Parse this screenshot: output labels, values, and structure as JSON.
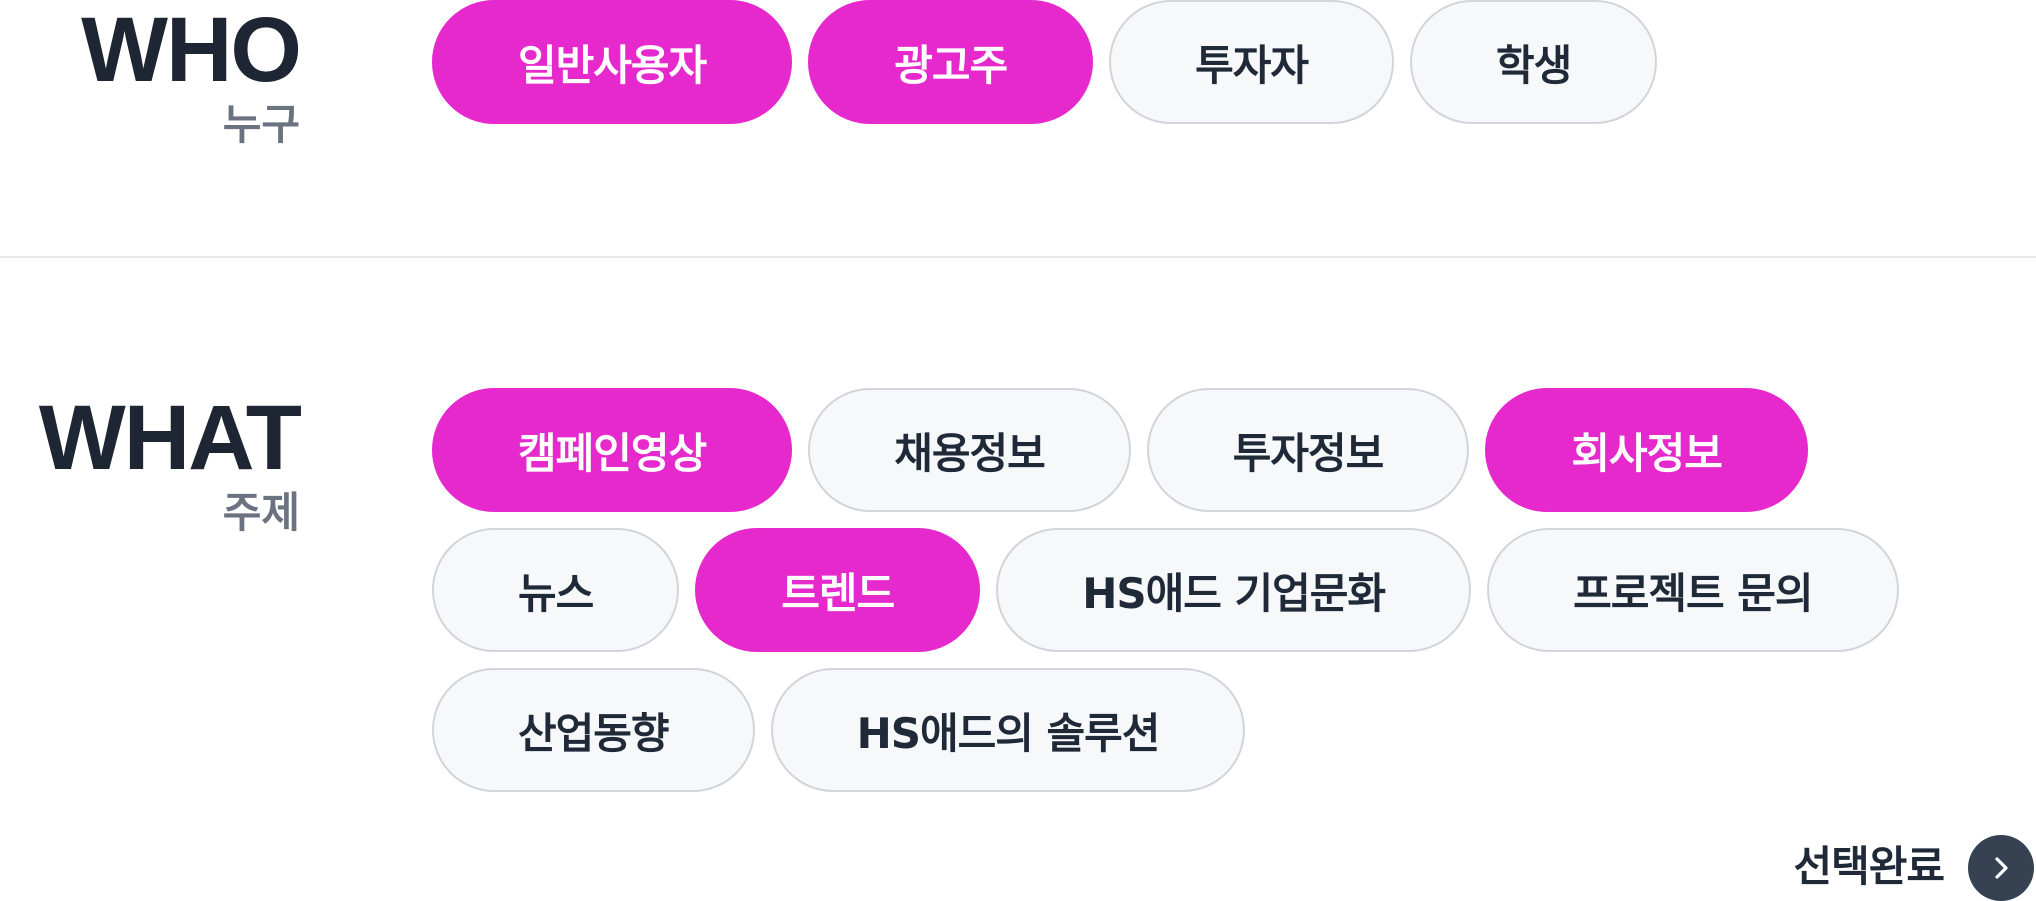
{
  "who": {
    "title_en": "WHO",
    "title_ko": "누구",
    "chips": [
      {
        "label": "일반사용자",
        "selected": true
      },
      {
        "label": "광고주",
        "selected": true
      },
      {
        "label": "투자자",
        "selected": false
      },
      {
        "label": "학생",
        "selected": false
      }
    ]
  },
  "what": {
    "title_en": "WHAT",
    "title_ko": "주제",
    "chips": [
      {
        "label": "캠페인영상",
        "selected": true
      },
      {
        "label": "채용정보",
        "selected": false
      },
      {
        "label": "투자정보",
        "selected": false
      },
      {
        "label": "회사정보",
        "selected": true
      },
      {
        "label": "뉴스",
        "selected": false
      },
      {
        "label": "트렌드",
        "selected": true
      },
      {
        "label": "HS애드 기업문화",
        "selected": false
      },
      {
        "label": "프로젝트 문의",
        "selected": false
      },
      {
        "label": "산업동향",
        "selected": false
      },
      {
        "label": "HS애드의 솔루션",
        "selected": false
      }
    ]
  },
  "footer": {
    "done_label": "선택완료",
    "done_icon": "chevron-right-icon"
  },
  "colors": {
    "selected": "#e629cd",
    "unselected_bg": "#f7f8fa",
    "text_dark": "#1f2937",
    "subtitle": "#6b7280",
    "button_bg": "#364152"
  }
}
